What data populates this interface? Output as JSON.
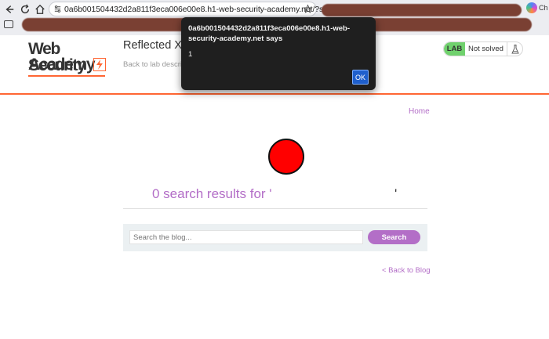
{
  "browser": {
    "url": "0a6b001504432d2a811f3eca006e00e8.h1-web-security-academy.net/?search=...",
    "extension_label": "Ch"
  },
  "site": {
    "logo_line1": "Web Security",
    "logo_line2": "Academy",
    "lab_title": "Reflected XS",
    "back_to_lab": "Back to lab descrip",
    "lab_badge": "LAB",
    "lab_status": "Not solved",
    "home_link": "Home",
    "results_text": "0 search results for '",
    "results_close": "'",
    "search_placeholder": "Search the blog...",
    "search_button": "Search",
    "back_to_blog": "< Back to Blog"
  },
  "dialog": {
    "title": "0a6b001504432d2a811f3eca006e00e8.h1-web-security-academy.net says",
    "message": "1",
    "ok_label": "OK"
  },
  "colors": {
    "accent_purple": "#b36ec7",
    "brand_orange": "#ff6633",
    "lab_green": "#70d16d",
    "payload_circle": "#ff0000"
  }
}
